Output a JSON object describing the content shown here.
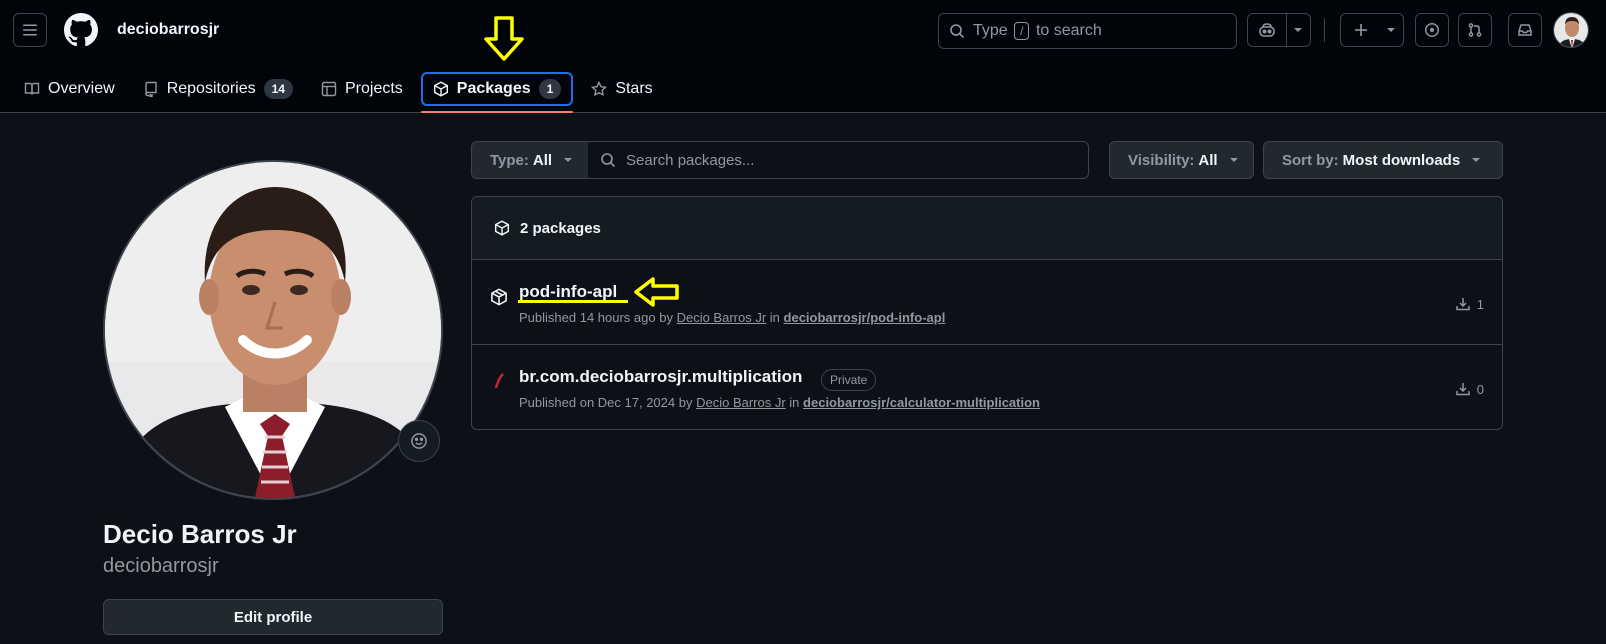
{
  "header": {
    "owner": "deciobarrosjr",
    "search_prefix": "Type",
    "search_key": "/",
    "search_suffix": "to search"
  },
  "tabs": [
    {
      "label": "Overview"
    },
    {
      "label": "Repositories",
      "count": "14"
    },
    {
      "label": "Projects"
    },
    {
      "label": "Packages",
      "count": "1"
    },
    {
      "label": "Stars"
    }
  ],
  "profile": {
    "name": "Decio Barros Jr",
    "login": "deciobarrosjr",
    "edit_label": "Edit profile"
  },
  "filters": {
    "type_label": "Type:",
    "type_value": "All",
    "search_placeholder": "Search packages...",
    "visibility_label": "Visibility:",
    "visibility_value": "All",
    "sort_label": "Sort by:",
    "sort_value": "Most downloads"
  },
  "packages": {
    "summary": "2 packages",
    "items": [
      {
        "name": "pod-info-apl",
        "published": "Published 14 hours ago by",
        "author": "Decio Barros Jr",
        "in": "in",
        "repo": "deciobarrosjr/pod-info-apl",
        "downloads": "1"
      },
      {
        "name": "br.com.deciobarrosjr.multiplication",
        "badge": "Private",
        "published": "Published on Dec 17, 2024 by",
        "author": "Decio Barros Jr",
        "in": "in",
        "repo": "deciobarrosjr/calculator-multiplication",
        "downloads": "0"
      }
    ]
  },
  "colors": {
    "background": "#0d1117",
    "header": "#010409",
    "border": "#3d444d",
    "accent_underline": "#f78166",
    "focus_ring": "#1f6feb",
    "annotation": "#ffff00"
  }
}
